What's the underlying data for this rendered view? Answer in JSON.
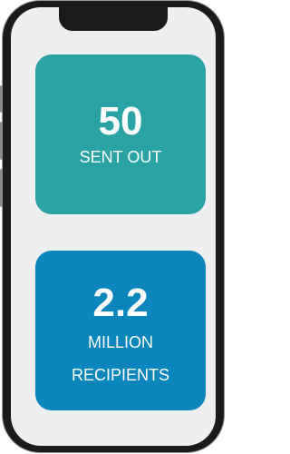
{
  "stats": [
    {
      "value": "50",
      "label_lines": [
        "SENT OUT"
      ],
      "color": "#2aa3a5"
    },
    {
      "value": "2.2",
      "label_lines": [
        "MILLION",
        "RECIPIENTS"
      ],
      "color": "#0a86bd"
    }
  ]
}
